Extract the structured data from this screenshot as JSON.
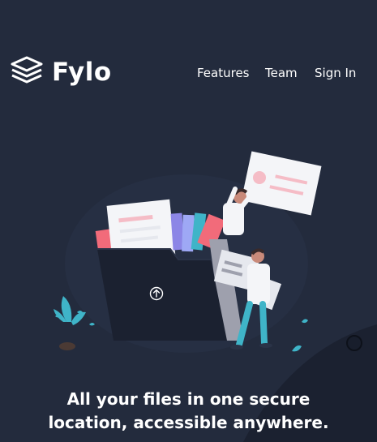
{
  "brand": {
    "name": "Fylo",
    "logo_icon": "stacked-layers-icon"
  },
  "nav": {
    "items": [
      {
        "label": "Features"
      },
      {
        "label": "Team"
      },
      {
        "label": "Sign In"
      }
    ]
  },
  "hero": {
    "illustration": "file-folder-illustration",
    "upload_icon": "upload-arrow-icon",
    "headline_line1": "All your files in one secure",
    "headline_line2": "location, accessible anywhere."
  },
  "colors": {
    "background": "#232b3d",
    "curve": "#1b2130",
    "folder": "#1b2130",
    "accent_teal": "#3fb4c8",
    "text": "#ffffff"
  }
}
